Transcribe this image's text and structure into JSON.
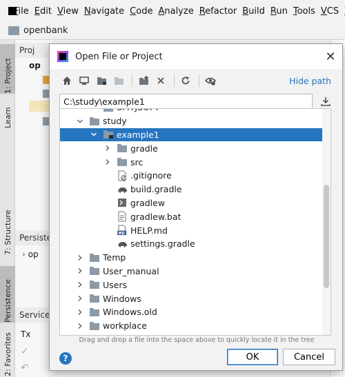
{
  "menubar": {
    "items": [
      {
        "label": "File"
      },
      {
        "label": "Edit"
      },
      {
        "label": "View"
      },
      {
        "label": "Navigate"
      },
      {
        "label": "Code"
      },
      {
        "label": "Analyze"
      },
      {
        "label": "Refactor"
      },
      {
        "label": "Build"
      },
      {
        "label": "Run"
      },
      {
        "label": "Tools"
      },
      {
        "label": "VCS"
      },
      {
        "label": "W"
      }
    ]
  },
  "navbar": {
    "project": "openbank"
  },
  "sidebar": {
    "tabs": [
      {
        "label": "1: Project"
      },
      {
        "label": "Learn"
      },
      {
        "label": "7: Structure"
      },
      {
        "label": "Persistence"
      },
      {
        "label": "2: Favorites"
      }
    ]
  },
  "background_panels": {
    "project_head": "Proj",
    "project_root": "op",
    "persistence_head": "Persiste",
    "persistence_item": "op",
    "services_head": "Services",
    "tx_label": "Tx"
  },
  "dialog": {
    "title": "Open File or Project",
    "hide_path": "Hide path",
    "path_value": "C:\\study\\example1",
    "hint": "Drag and drop a file into the space above to quickly locate it in the tree",
    "ok": "OK",
    "cancel": "Cancel",
    "help": "?",
    "tree": [
      {
        "label": "SMTJSOFT",
        "type": "folder",
        "level": 2,
        "arrow": "none"
      },
      {
        "label": "study",
        "type": "folder",
        "level": 1,
        "arrow": "down"
      },
      {
        "label": "example1",
        "type": "project",
        "level": 2,
        "arrow": "down",
        "selected": true
      },
      {
        "label": "gradle",
        "type": "folder",
        "level": 3,
        "arrow": "right"
      },
      {
        "label": "src",
        "type": "folder",
        "level": 3,
        "arrow": "right"
      },
      {
        "label": ".gitignore",
        "type": "ignore",
        "level": 3,
        "arrow": "none"
      },
      {
        "label": "build.gradle",
        "type": "gradle",
        "level": 3,
        "arrow": "none"
      },
      {
        "label": "gradlew",
        "type": "shell",
        "level": 3,
        "arrow": "none"
      },
      {
        "label": "gradlew.bat",
        "type": "text",
        "level": 3,
        "arrow": "none"
      },
      {
        "label": "HELP.md",
        "type": "md",
        "level": 3,
        "arrow": "none"
      },
      {
        "label": "settings.gradle",
        "type": "gradle",
        "level": 3,
        "arrow": "none"
      },
      {
        "label": "Temp",
        "type": "folder",
        "level": 1,
        "arrow": "right"
      },
      {
        "label": "User_manual",
        "type": "folder",
        "level": 1,
        "arrow": "right"
      },
      {
        "label": "Users",
        "type": "folder",
        "level": 1,
        "arrow": "right"
      },
      {
        "label": "Windows",
        "type": "folder",
        "level": 1,
        "arrow": "right"
      },
      {
        "label": "Windows.old",
        "type": "folder",
        "level": 1,
        "arrow": "right"
      },
      {
        "label": "workplace",
        "type": "folder",
        "level": 1,
        "arrow": "right"
      }
    ]
  },
  "colors": {
    "accent": "#2675bf",
    "folder": "#8c9aa7",
    "selection": "#2675bf"
  }
}
